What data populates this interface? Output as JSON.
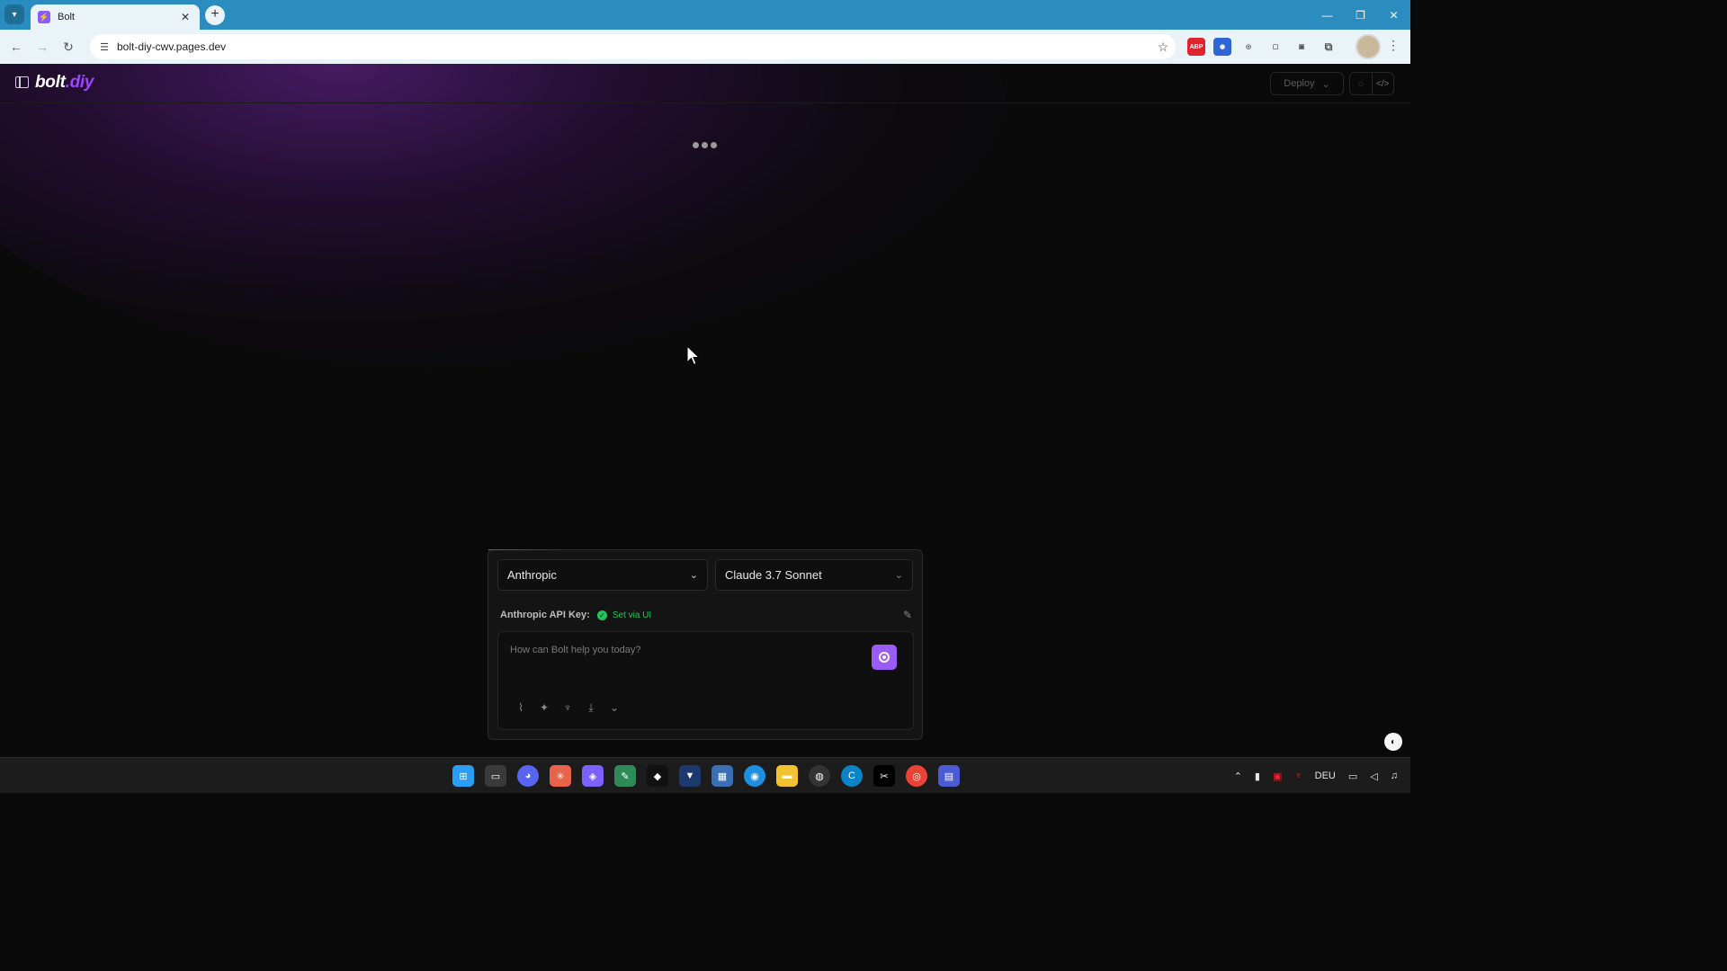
{
  "browser": {
    "tab_title": "Bolt",
    "url": "bolt-diy-cwv.pages.dev",
    "extensions": [
      "ABP",
      "password-manager",
      "camera",
      "clipboard",
      "tab-manager",
      "puzzle"
    ]
  },
  "app": {
    "logo_part1": "bolt",
    "logo_part2": ".diy",
    "deploy_label": "Deploy",
    "provider_select": "Anthropic",
    "model_select": "Claude 3.7 Sonnet",
    "api_key_label": "Anthropic API Key:",
    "api_key_status": "Set via UI",
    "prompt_placeholder": "How can Bolt help you today?",
    "accent_color": "#9b5cf6",
    "status_color": "#22c55e"
  },
  "taskbar": {
    "language": "DEU"
  }
}
